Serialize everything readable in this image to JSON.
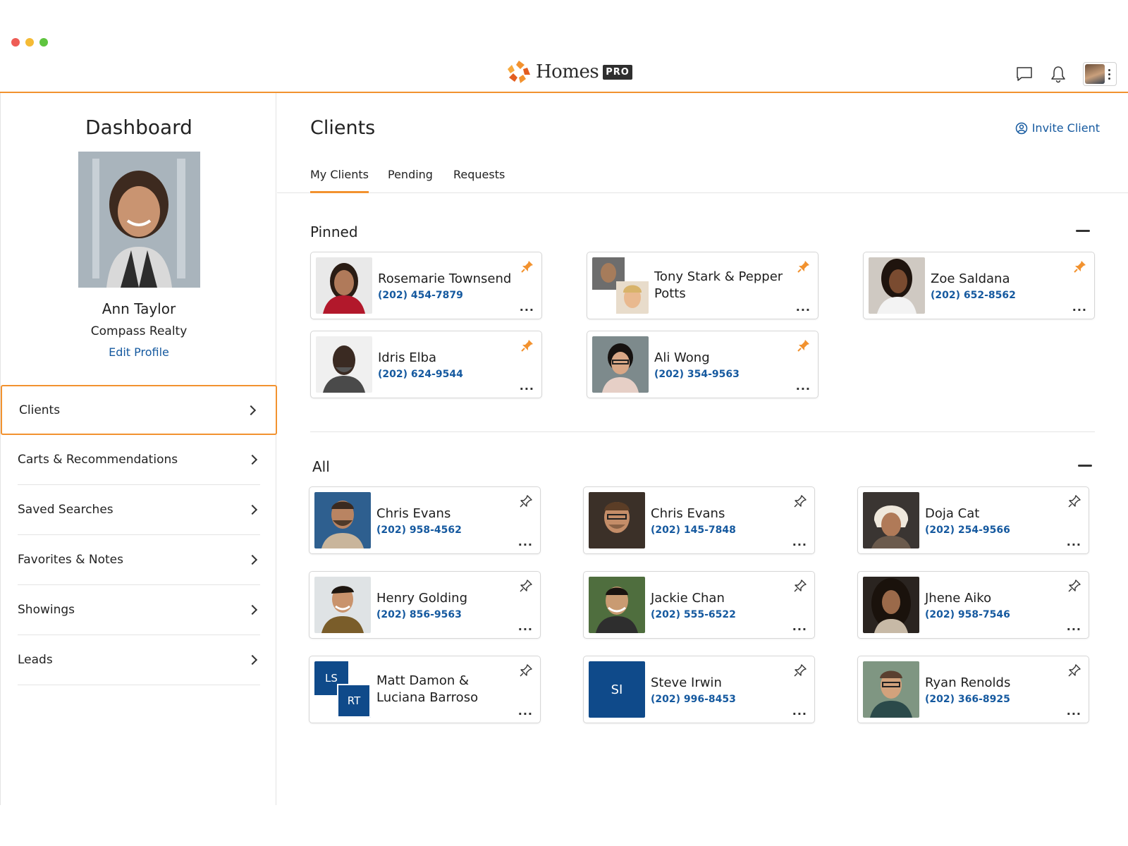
{
  "brand": {
    "name": "Homes",
    "badge": "PRO",
    "accent": "#f2922f",
    "link_color": "#15599f"
  },
  "header": {
    "icons": [
      "chat-icon",
      "bell-icon",
      "avatar",
      "kebab-icon"
    ]
  },
  "sidebar": {
    "title": "Dashboard",
    "profile": {
      "name": "Ann Taylor",
      "company": "Compass Realty",
      "edit_label": "Edit Profile"
    },
    "items": [
      {
        "label": "Clients",
        "active": true
      },
      {
        "label": "Carts & Recommendations"
      },
      {
        "label": "Saved Searches"
      },
      {
        "label": "Favorites & Notes"
      },
      {
        "label": "Showings"
      },
      {
        "label": "Leads"
      }
    ]
  },
  "main": {
    "title": "Clients",
    "invite_label": "Invite Client",
    "tabs": [
      {
        "label": "My Clients",
        "active": true
      },
      {
        "label": "Pending"
      },
      {
        "label": "Requests"
      }
    ],
    "pinned": {
      "title": "Pinned",
      "clients": [
        {
          "name": "Rosemarie Townsend",
          "phone": "(202) 454-7879"
        },
        {
          "name": "Tony Stark & Pepper Potts",
          "phone": ""
        },
        {
          "name": "Zoe Saldana",
          "phone": "(202) 652-8562"
        },
        {
          "name": "Idris Elba",
          "phone": "(202) 624-9544"
        },
        {
          "name": "Ali Wong",
          "phone": "(202) 354-9563"
        }
      ]
    },
    "all": {
      "title": "All",
      "clients": [
        {
          "name": "Chris Evans",
          "phone": "(202) 958-4562"
        },
        {
          "name": "Chris Evans",
          "phone": "(202) 145-7848"
        },
        {
          "name": "Doja Cat",
          "phone": "(202) 254-9566"
        },
        {
          "name": "Henry Golding",
          "phone": "(202) 856-9563"
        },
        {
          "name": "Jackie Chan",
          "phone": "(202) 555-6522"
        },
        {
          "name": "Jhene Aiko",
          "phone": "(202) 958-7546"
        },
        {
          "name": "Matt Damon & Luciana Barroso",
          "phone": "",
          "initials": [
            "LS",
            "RT"
          ]
        },
        {
          "name": "Steve Irwin",
          "phone": "(202) 996-8453",
          "initials": [
            "SI"
          ]
        },
        {
          "name": "Ryan Renolds",
          "phone": "(202) 366-8925"
        }
      ]
    },
    "more_label": "..."
  }
}
